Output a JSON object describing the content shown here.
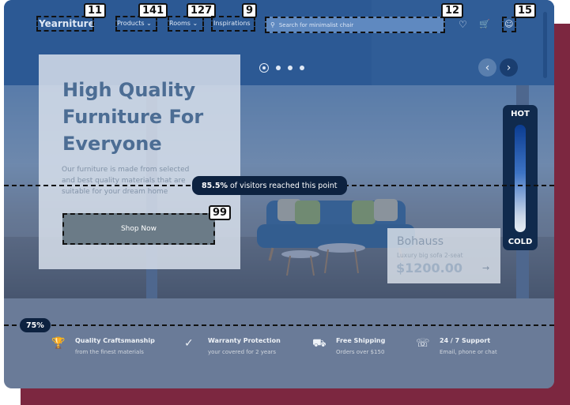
{
  "app": {
    "logo": "Yearniture",
    "nav": [
      {
        "label": "Products",
        "count": "141"
      },
      {
        "label": "Rooms",
        "count": "127"
      },
      {
        "label": "Inspirations",
        "count": "9"
      }
    ],
    "logo_count": "11",
    "search": {
      "placeholder": "Search for minimalist chair",
      "count": "12"
    },
    "account_count": "15"
  },
  "hero": {
    "headline": "High Quality Furniture For Everyone",
    "description": "Our furniture is made from selected and best quality materials that are suitable for your dream home",
    "cta_label": "Shop Now",
    "cta_count": "99",
    "slider_dots": 4,
    "active_dot": 0
  },
  "product": {
    "name": "Bohauss",
    "subtitle": "Luxury big sofa 2-seat",
    "price": "$1200.00"
  },
  "heatmap_legend": {
    "top": "HOT",
    "bottom": "COLD"
  },
  "scroll_markers": [
    {
      "percent": "85.5%",
      "text": " of visitors reached this point"
    },
    {
      "percent": "75%"
    }
  ],
  "features": [
    {
      "icon": "trophy-icon",
      "title": "Quality Craftsmanship",
      "subtitle": "from the finest materials"
    },
    {
      "icon": "check-circle-icon",
      "title": "Warranty Protection",
      "subtitle": "your covered for 2 years"
    },
    {
      "icon": "truck-icon",
      "title": "Free Shipping",
      "subtitle": "Orders over $150"
    },
    {
      "icon": "headset-icon",
      "title": "24 / 7 Support",
      "subtitle": "Email, phone or chat"
    }
  ],
  "colors": {
    "brand": "#2c5994",
    "hero_text": "#4c6d94",
    "cta": "#6b7b87",
    "accent_dark": "#0d2240",
    "outer_frame": "#7c2740"
  }
}
